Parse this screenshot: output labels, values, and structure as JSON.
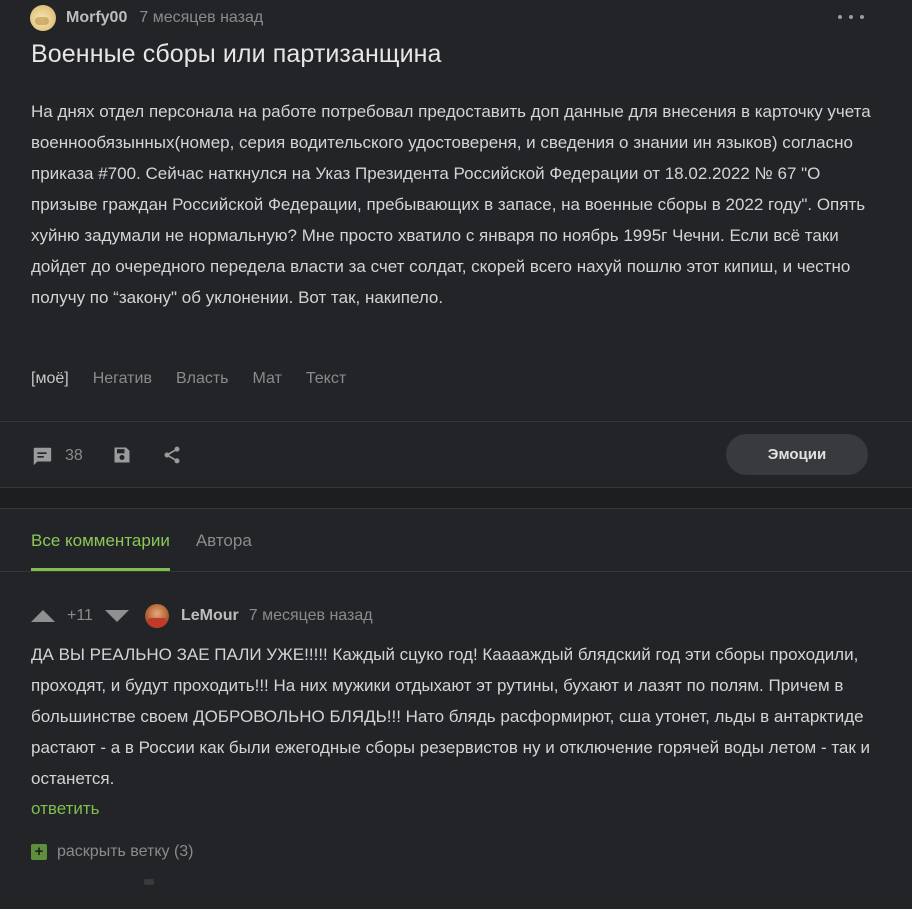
{
  "post": {
    "author": "Morfy00",
    "time": "7 месяцев назад",
    "title": "Военные сборы или партизанщина",
    "text": "На днях отдел персонала на работе потребовал предоставить доп данные для внесения в карточку учета военнообязынных(номер, серия водительского удостовереня, и сведения о знании ин языков) согласно приказа #700. Сейчас наткнулся на Указ Президента Российской Федерации от 18.02.2022 № 67 \"О призыве граждан Российской Федерации, пребывающих в запасе, на военные сборы в 2022 году\". Опять хуйню задумали не нормальную? Мне просто хватило с января по ноябрь 1995г Чечни. Если всё таки дойдет до очередного передела власти за счет солдат, скорей всего нахуй пошлю этот кипиш, и честно получу по “закону\" об уклонении. Вот так, накипело.",
    "tags": [
      "[моё]",
      "Негатив",
      "Власть",
      "Мат",
      "Текст"
    ],
    "comment_count": "38",
    "emotions_label": "Эмоции"
  },
  "icons": {
    "more": "more-dots-icon",
    "comments": "comment-bubble-icon",
    "save": "save-icon",
    "share": "share-icon",
    "vote_up": "arrow-up-icon",
    "vote_down": "arrow-down-icon",
    "expand": "plus-icon"
  },
  "colors": {
    "accent": "#7fbf4d",
    "background": "#1d1e20",
    "card": "#232427",
    "muted_text": "#8a8b8d"
  },
  "comments": {
    "tabs": [
      {
        "label": "Все комментарии",
        "active": true
      },
      {
        "label": "Автора",
        "active": false
      }
    ],
    "items": [
      {
        "rating": "+11",
        "author": "LeMour",
        "time": "7 месяцев назад",
        "text": "ДА ВЫ РЕАЛЬНО ЗАЕ ПАЛИ УЖЕ!!!!! Каждый сцуко год! Кааааждый блядский год эти сборы проходили, проходят, и будут проходить!!! На них мужики отдыхают эт рутины, бухают и лазят по полям. Причем в большинстве своем ДОБРОВОЛЬНО БЛЯДЬ!!! Нато блядь расформирют, сша утонет, льды в антарктиде растают - а в России как были ежегодные сборы резервистов ну и отключение горячей воды летом - так и останется.",
        "reply_label": "ответить",
        "expand_label": "раскрыть ветку (3)"
      }
    ]
  }
}
